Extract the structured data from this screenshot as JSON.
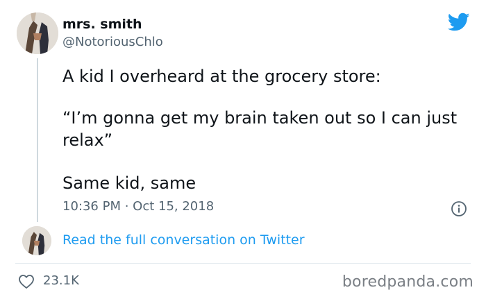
{
  "author": {
    "name": "mrs. smith",
    "handle": "@NotoriousChlo"
  },
  "tweet": {
    "line1": "A kid I overheard at the grocery store:",
    "line2": "“I’m gonna get my brain taken out so I can just relax”",
    "line3": "Same kid, same",
    "timestamp": "10:36 PM · Oct 15, 2018"
  },
  "conversation_link": "Read the full conversation on Twitter",
  "likes": "23.1K",
  "watermark": "boredpanda.com",
  "icons": {
    "brand": "twitter-bird-icon",
    "info": "info-icon",
    "like": "heart-icon"
  },
  "colors": {
    "twitter_blue": "#1d9bf0",
    "text": "#0f1419",
    "secondary": "#536471"
  }
}
